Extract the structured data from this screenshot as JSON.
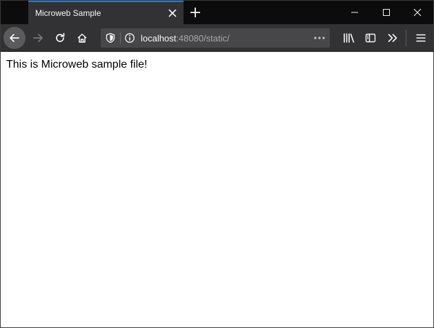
{
  "browser": {
    "tab": {
      "title": "Microweb Sample"
    },
    "urlbar": {
      "host": "localhost",
      "rest": ":48080/static/"
    }
  },
  "page": {
    "text": "This is Microweb sample file!"
  },
  "icons": {
    "tab_close": "close-icon",
    "new_tab": "plus-icon",
    "minimize": "minimize-icon",
    "maximize": "maximize-icon",
    "close": "close-icon",
    "back": "arrow-left-icon",
    "forward": "arrow-right-icon",
    "reload": "reload-icon",
    "home": "home-icon",
    "shield": "shield-icon",
    "info": "info-icon",
    "more": "more-horizontal-icon",
    "library": "library-icon",
    "sidebar": "sidebar-icon",
    "overflow": "chevron-double-right-icon",
    "menu": "hamburger-menu-icon"
  },
  "colors": {
    "accent": "#0a84ff",
    "chrome_dark": "#0c0c0d",
    "toolbar": "#323234",
    "urlbar": "#474749",
    "text_light": "#f9f9fa",
    "text_muted": "#a8a8ac"
  }
}
